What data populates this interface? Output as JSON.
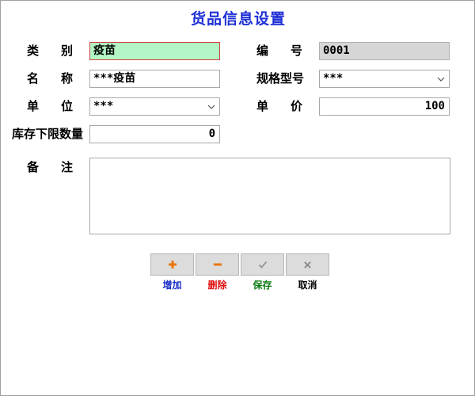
{
  "title": "货品信息设置",
  "labels": {
    "category": [
      "类",
      "别"
    ],
    "code": [
      "编",
      "号"
    ],
    "name": [
      "名",
      "称"
    ],
    "spec": "规格型号",
    "unit": [
      "单",
      "位"
    ],
    "price": [
      "单",
      "价"
    ],
    "min_stock": "库存下限数量",
    "remark": [
      "备",
      "注"
    ]
  },
  "fields": {
    "category": "疫苗",
    "code": "0001",
    "name": "***疫苗",
    "spec": "***",
    "unit": "***",
    "price": "100",
    "min_stock": "0",
    "remark": ""
  },
  "buttons": {
    "add": "增加",
    "delete": "删除",
    "save": "保存",
    "cancel": "取消"
  },
  "colors": {
    "title": "#1e2fd6",
    "add": "#1a2ec9",
    "delete": "#e01010",
    "save": "#0a7a12",
    "cancel": "#000000",
    "plus_icon": "#e8750b",
    "minus_icon": "#e8750b",
    "check_icon": "#9a9a9a",
    "x_icon": "#8a8a8a"
  },
  "icons": {
    "add": "plus-icon",
    "delete": "minus-icon",
    "save": "check-icon",
    "cancel": "x-icon",
    "dropdown": "chevron-down-icon"
  }
}
